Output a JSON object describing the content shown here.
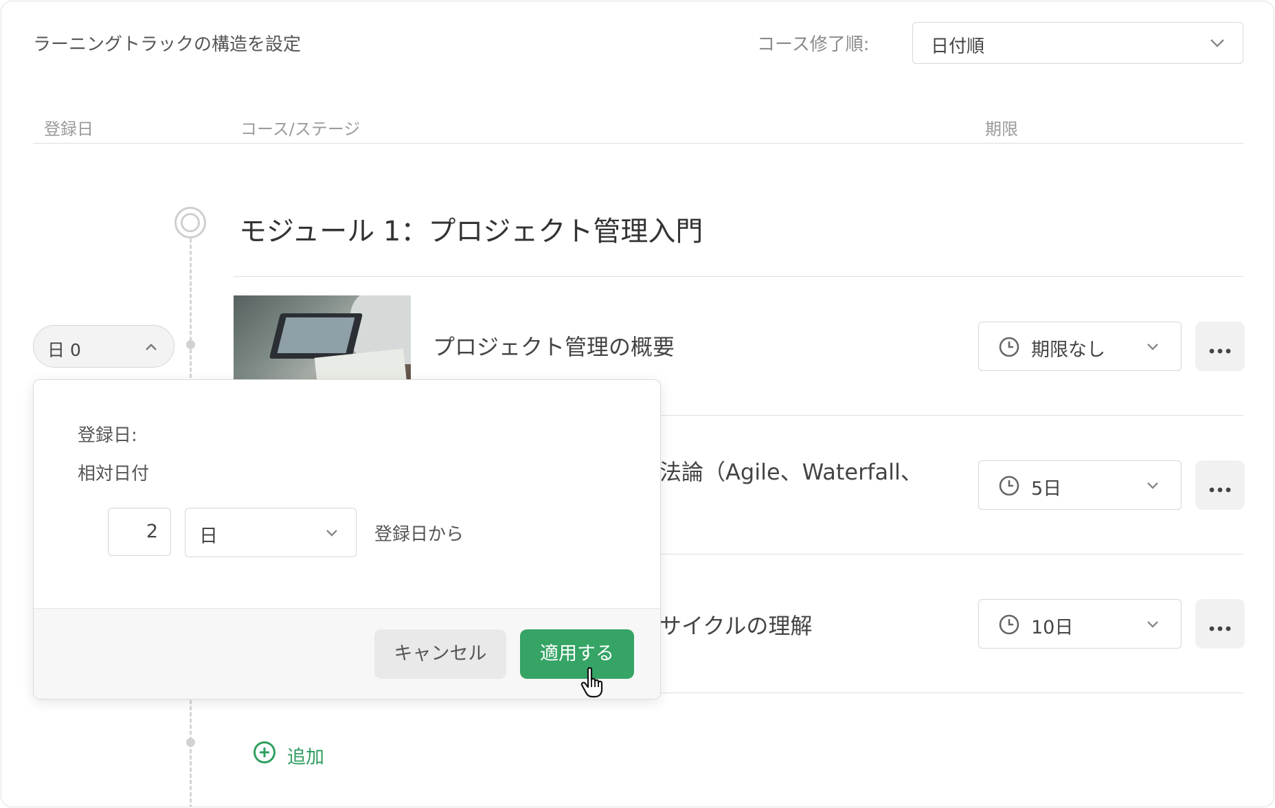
{
  "header": {
    "title": "ラーニングトラックの構造を設定",
    "order_label": "コース修了順:",
    "order_value": "日付順"
  },
  "columns": {
    "enroll_date": "登録日",
    "course_stage": "コース/ステージ",
    "deadline": "期限"
  },
  "module": {
    "title": "モジュール 1：プロジェクト管理入門"
  },
  "courses": [
    {
      "title": "プロジェクト管理の概要",
      "deadline": "期限なし"
    },
    {
      "title": "法論（Agile、Waterfall、",
      "deadline": "5日"
    },
    {
      "title": "サイクルの理解",
      "deadline": "10日"
    }
  ],
  "day_pill": {
    "value": "日 0"
  },
  "add": {
    "label": "追加"
  },
  "popover": {
    "enroll_label": "登録日:",
    "relative_label": "相対日付",
    "amount": "2",
    "unit": "日",
    "from_label": "登録日から",
    "cancel": "キャンセル",
    "apply": "適用する"
  },
  "colors": {
    "accent_green": "#35a465",
    "border": "#d7d7d7"
  },
  "icons": {
    "chevron": "chevron-down-icon",
    "clock": "clock-icon",
    "more": "more-horizontal-icon",
    "plus": "plus-circle-icon",
    "cursor": "hand-pointer-icon"
  }
}
